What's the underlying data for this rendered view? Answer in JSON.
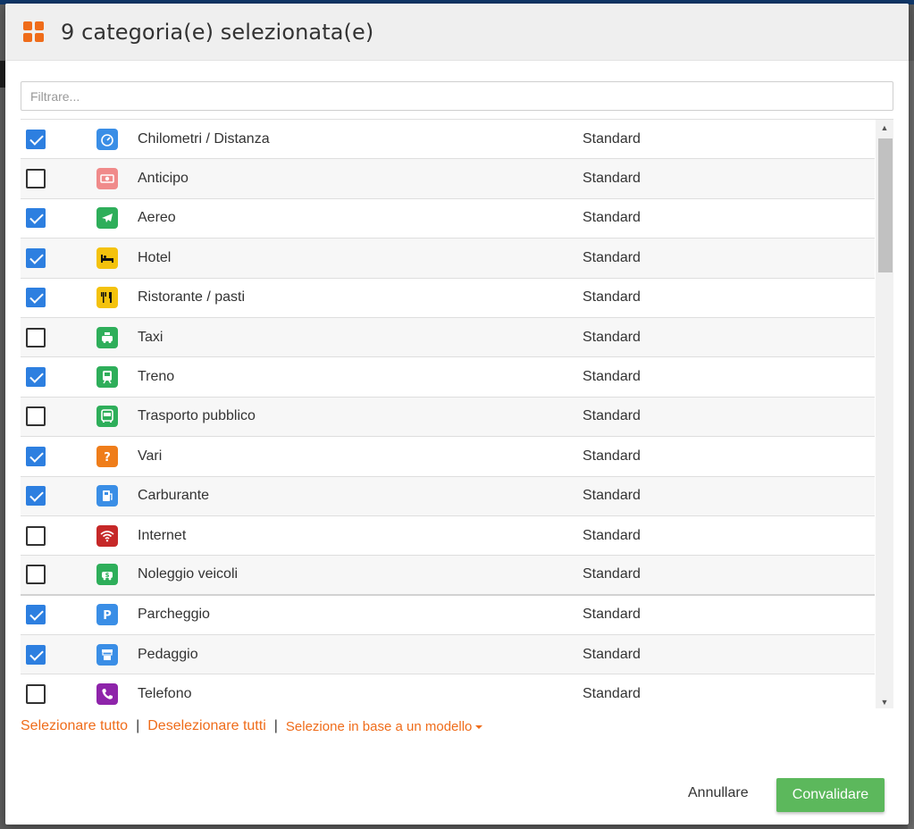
{
  "dialog": {
    "title": "9 categoria(e) selezionata(e)",
    "filter_placeholder": "Filtrare..."
  },
  "categories": [
    {
      "name": "Chilometri / Distanza",
      "type": "Standard",
      "checked": true,
      "icon": "speedometer-icon",
      "color": "#3a8ee6"
    },
    {
      "name": "Anticipo",
      "type": "Standard",
      "checked": false,
      "icon": "cash-icon",
      "color": "#f08a8a"
    },
    {
      "name": "Aereo",
      "type": "Standard",
      "checked": true,
      "icon": "airplane-icon",
      "color": "#2eae5a"
    },
    {
      "name": "Hotel",
      "type": "Standard",
      "checked": true,
      "icon": "bed-icon",
      "color": "#f4c20d"
    },
    {
      "name": "Ristorante / pasti",
      "type": "Standard",
      "checked": true,
      "icon": "cutlery-icon",
      "color": "#f4c20d"
    },
    {
      "name": "Taxi",
      "type": "Standard",
      "checked": false,
      "icon": "taxi-icon",
      "color": "#2eae5a"
    },
    {
      "name": "Treno",
      "type": "Standard",
      "checked": true,
      "icon": "train-icon",
      "color": "#2eae5a"
    },
    {
      "name": "Trasporto pubblico",
      "type": "Standard",
      "checked": false,
      "icon": "bus-icon",
      "color": "#2eae5a"
    },
    {
      "name": "Vari",
      "type": "Standard",
      "checked": true,
      "icon": "question-icon",
      "color": "#ef7d1a"
    },
    {
      "name": "Carburante",
      "type": "Standard",
      "checked": true,
      "icon": "fuel-icon",
      "color": "#3a8ee6"
    },
    {
      "name": "Internet",
      "type": "Standard",
      "checked": false,
      "icon": "wifi-icon",
      "color": "#c62828"
    },
    {
      "name": "Noleggio veicoli",
      "type": "Standard",
      "checked": false,
      "icon": "car-rental-icon",
      "color": "#2eae5a"
    },
    {
      "name": "Parcheggio",
      "type": "Standard",
      "checked": true,
      "icon": "parking-icon",
      "color": "#3a8ee6"
    },
    {
      "name": "Pedaggio",
      "type": "Standard",
      "checked": true,
      "icon": "toll-icon",
      "color": "#3a8ee6"
    },
    {
      "name": "Telefono",
      "type": "Standard",
      "checked": false,
      "icon": "phone-icon",
      "color": "#8e24aa"
    }
  ],
  "actions": {
    "select_all": "Selezionare tutto",
    "deselect_all": "Deselezionare tutti",
    "select_by_template": "Selezione in base a un modello",
    "separator": "|"
  },
  "buttons": {
    "cancel": "Annullare",
    "confirm": "Convalidare"
  },
  "colors": {
    "accent": "#ef6c1a",
    "checkbox": "#2d7fe0",
    "confirm": "#5cb85c"
  }
}
